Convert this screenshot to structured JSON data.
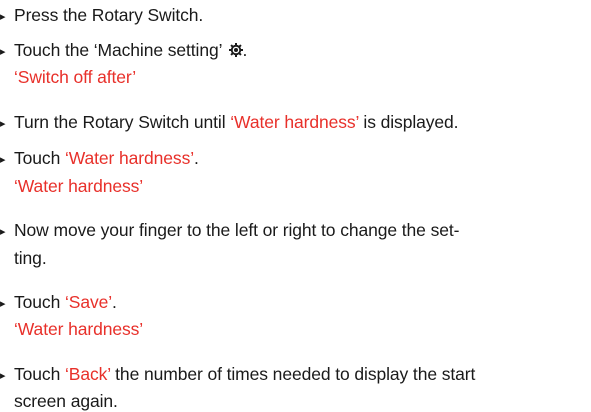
{
  "instructions": {
    "step1": "Press the Rotary Switch.",
    "step2_prefix": "Touch the ‘Machine setting’",
    "step2_suffix": ".",
    "result1": "‘Switch off after’",
    "step3_prefix": "Turn the Rotary Switch until ",
    "step3_highlight": "‘Water hardness’",
    "step3_suffix": " is displayed.",
    "step4_prefix": "Touch ",
    "step4_highlight": "‘Water hardness’",
    "step4_suffix": ".",
    "result2": "‘Water hardness’",
    "step5_line1": "Now move your finger to the left or right to change the set-",
    "step5_line2": "ting.",
    "step6_prefix": "Touch ",
    "step6_highlight": "‘Save’",
    "step6_suffix": ".",
    "result3": "‘Water hardness’",
    "step7_prefix": "Touch ",
    "step7_highlight": "‘Back’",
    "step7_suffix": " the number of times needed to display the start",
    "step7_line2": "screen again."
  },
  "bullet_glyph": "▸",
  "colors": {
    "text": "#1a1a1a",
    "highlight": "#e8302a"
  },
  "icons": {
    "machine_setting": "gear-icon"
  }
}
